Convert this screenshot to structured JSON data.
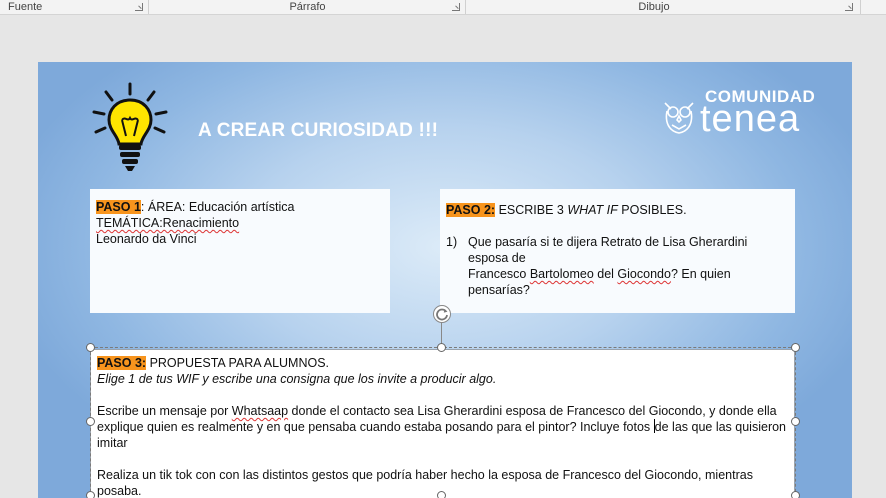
{
  "ribbon": {
    "groups": [
      {
        "label": "Fuente"
      },
      {
        "label": "Párrafo"
      },
      {
        "label": "Dibujo"
      }
    ]
  },
  "slide": {
    "title": "A CREAR CURIOSIDAD !!!",
    "logo": {
      "line1": "COMUNIDAD",
      "line2": "tenea"
    },
    "paso1": {
      "tag": "PASO 1",
      "area": ":  ÁREA: Educación artística",
      "tematica": "TEMÁTICA:Renacimiento",
      "person": "Leonardo da Vinci"
    },
    "paso2": {
      "tag": "PASO 2:",
      "heading_pre": " ESCRIBE 3 ",
      "heading_em": "WHAT IF",
      "heading_post": " POSIBLES.",
      "item_num": "1)",
      "item_line1": "Que pasaría  si te dijera Retrato de Lisa Gherardini esposa de",
      "item_line2_a": "Francesco ",
      "item_line2_b": "Bartolomeo",
      "item_line2_c": " del ",
      "item_line2_d": "Giocondo",
      "item_line2_e": "? En quien pensarías?"
    },
    "paso3": {
      "tag": "PASO 3:",
      "heading": " PROPUESTA PARA ALUMNOS.",
      "instruction": "Elige 1 de tus WIF y escribe una consigna que los invite a producir algo.",
      "para1_a": "Escribe un mensaje por ",
      "para1_b": "Whatsaap",
      "para1_c": " donde  el contacto sea Lisa Gherardini esposa de Francesco del Giocondo, y donde ella explique quien es realmente y en que pensaba cuando estaba posando para el pintor? Incluye fotos",
      "para1_d": "de las que las quisieron imitar",
      "para2": "Realiza un tik tok con con  las distintos gestos que podría haber hecho la esposa de Francesco del Giocondo, mientras posaba."
    }
  },
  "colors": {
    "highlight": "#f7941d",
    "title": "#ffffff",
    "slide_bg": "#8fb7e2"
  }
}
